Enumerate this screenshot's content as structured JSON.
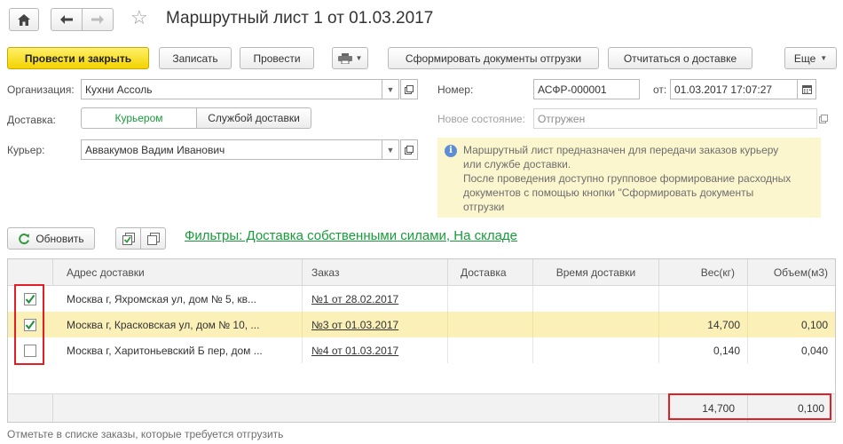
{
  "window": {
    "title": "Маршрутный лист 1 от 01.03.2017"
  },
  "toolbar": {
    "post_close": "Провести и закрыть",
    "save": "Записать",
    "post": "Провести",
    "form_docs": "Сформировать документы отгрузки",
    "report_delivery": "Отчитаться о доставке",
    "more": "Еще"
  },
  "form": {
    "org_label": "Организация:",
    "org_value": "Кухни Ассоль",
    "delivery_label": "Доставка:",
    "delivery_courier": "Курьером",
    "delivery_service": "Службой доставки",
    "courier_label": "Курьер:",
    "courier_value": "Аввакумов Вадим Иванович",
    "number_label": "Номер:",
    "number_value": "АСФР-000001",
    "date_label": "от:",
    "date_value": "01.03.2017 17:07:27",
    "state_label": "Новое состояние:",
    "state_value": "Отгружен"
  },
  "info": {
    "line1": "Маршрутный лист предназначен для передачи заказов курьеру",
    "line2": "или службе доставки.",
    "line3": "После проведения доступно групповое формирование расходных",
    "line4": "документов с помощью кнопки \"Сформировать документы",
    "line5": "отгрузки"
  },
  "list_toolbar": {
    "refresh": "Обновить",
    "filters_link": "Фильтры: Доставка собственными силами, На складе"
  },
  "table": {
    "headers": {
      "address": "Адрес доставки",
      "order": "Заказ",
      "delivery": "Доставка",
      "time": "Время доставки",
      "weight": "Вес(кг)",
      "volume": "Объем(м3)"
    },
    "rows": [
      {
        "checked": true,
        "address": "Москва г, Яхромская ул, дом № 5, кв...",
        "order": "№1 от 28.02.2017",
        "delivery": "",
        "time": "",
        "weight": "",
        "volume": ""
      },
      {
        "checked": true,
        "address": "Москва г, Красковская ул, дом № 10, ...",
        "order": "№3 от 01.03.2017",
        "delivery": "",
        "time": "",
        "weight": "14,700",
        "volume": "0,100"
      },
      {
        "checked": false,
        "address": "Москва г, Харитоньевский Б пер, дом ...",
        "order": "№4 от 01.03.2017",
        "delivery": "",
        "time": "",
        "weight": "0,140",
        "volume": "0,040"
      }
    ],
    "totals": {
      "weight": "14,700",
      "volume": "0,100"
    }
  },
  "footer": {
    "hint": "Отметьте в списке заказы, которые требуется отгрузить"
  },
  "colors": {
    "accent_yellow": "#f3d300",
    "selected_row": "#fbf0b8",
    "link_green": "#1a9b3b",
    "highlight_red": "#e31e24"
  }
}
